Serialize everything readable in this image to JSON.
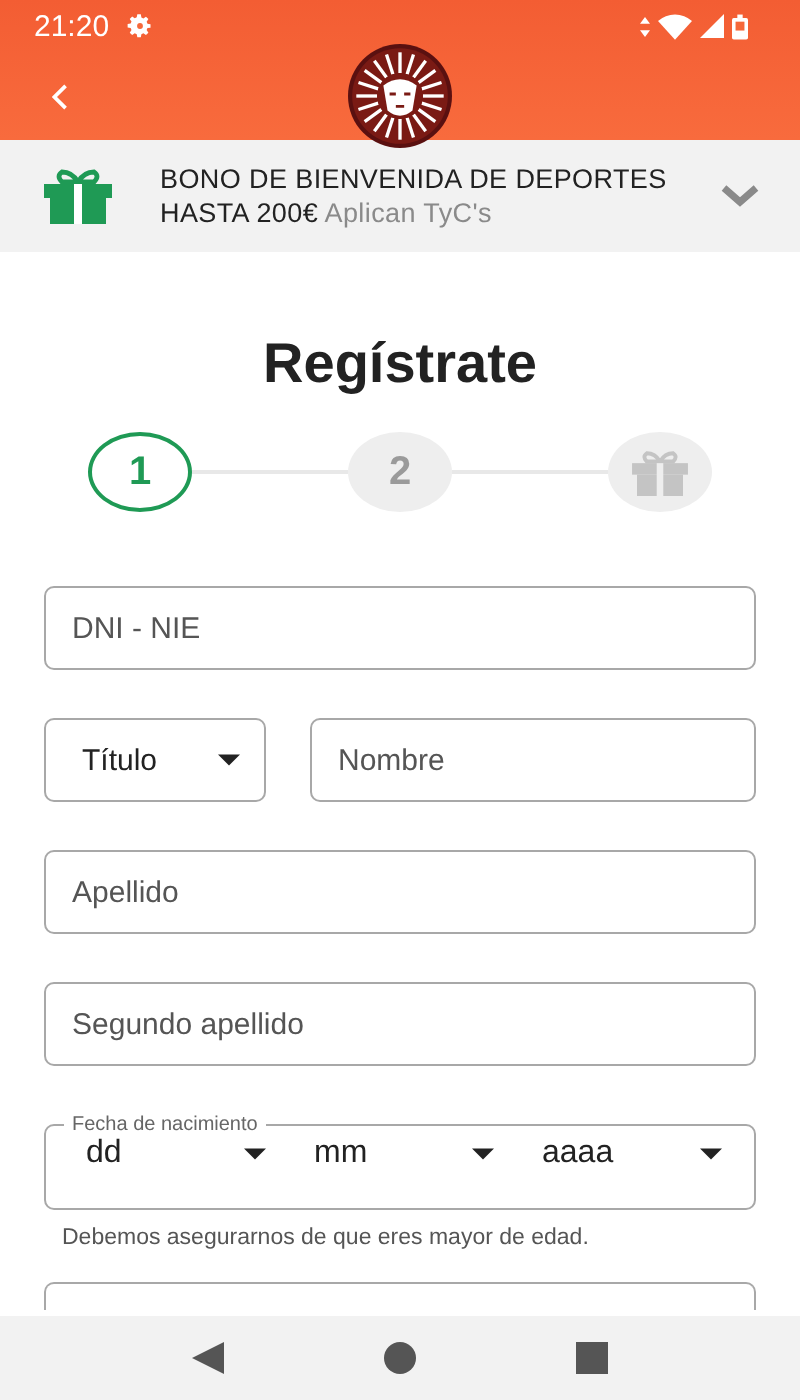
{
  "status_bar": {
    "time": "21:20"
  },
  "banner": {
    "title": "BONO DE BIENVENIDA DE DEPORTES HASTA 200€",
    "note": "Aplican TyC's",
    "expanded": false
  },
  "heading": "Regístrate",
  "steps": [
    {
      "kind": "number",
      "label": "1",
      "selected": true
    },
    {
      "kind": "number",
      "label": "2",
      "selected": false
    },
    {
      "kind": "gift",
      "selected": false
    }
  ],
  "form_rows": [
    {
      "fields": [
        {
          "kind": "text",
          "placeholder": "DNI - NIE"
        }
      ]
    },
    {
      "fields": [
        {
          "kind": "select",
          "value": "Título"
        },
        {
          "kind": "text",
          "placeholder": "Nombre"
        }
      ]
    },
    {
      "fields": [
        {
          "kind": "text",
          "placeholder": "Apellido"
        }
      ]
    },
    {
      "fields": [
        {
          "kind": "text",
          "placeholder": "Segundo apellido"
        }
      ]
    },
    {
      "fields": [
        {
          "kind": "date",
          "label": "Fecha de nacimiento",
          "parts": [
            "dd",
            "mm",
            "aaaa"
          ],
          "hint": "Debemos asegurarnos de que eres mayor de edad."
        }
      ]
    },
    {
      "fields": [
        {
          "kind": "blank"
        }
      ]
    }
  ]
}
